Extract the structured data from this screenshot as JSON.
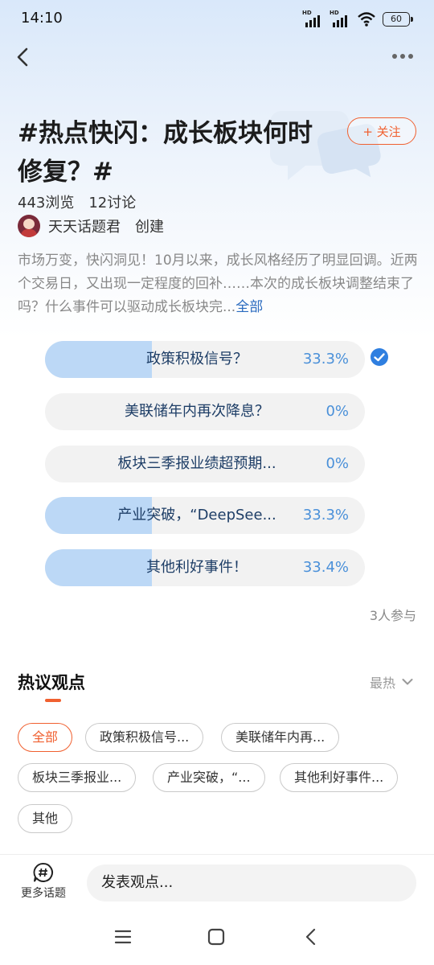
{
  "status_bar": {
    "time": "14:10",
    "network_label": "HD",
    "battery": "60",
    "icons": [
      "signal-icon",
      "signal-icon",
      "wifi-icon",
      "battery-icon"
    ]
  },
  "nav": {
    "back_icon": "chevron-left-icon",
    "more_icon": "more-dots-icon"
  },
  "topic": {
    "title": "#热点快闪：成长板块何时修复？#",
    "follow_label": "+ 关注",
    "views": "443浏览",
    "discussions": "12讨论",
    "creator_name": "天天话题君",
    "creator_action": "创建",
    "description": "市场万变，快闪洞见！10月以来，成长风格经历了明显回调。近两个交易日，又出现一定程度的回补……本次的成长板块调整结束了吗？什么事件可以驱动成长板块完...",
    "description_more": "全部"
  },
  "poll": {
    "options": [
      {
        "label": "政策积极信号？",
        "percent": "33.3%",
        "fill": 0.333,
        "selected": true
      },
      {
        "label": "美联储年内再次降息？",
        "percent": "0%",
        "fill": 0,
        "selected": false
      },
      {
        "label": "板块三季报业绩超预期...",
        "percent": "0%",
        "fill": 0,
        "selected": false
      },
      {
        "label": "产业突破，“DeepSee...",
        "percent": "33.3%",
        "fill": 0.333,
        "selected": false
      },
      {
        "label": "其他利好事件！",
        "percent": "33.4%",
        "fill": 0.334,
        "selected": false
      }
    ],
    "participants": "3人参与"
  },
  "hot_views": {
    "title": "热议观点",
    "sort_label": "最热",
    "filters": [
      "全部",
      "政策积极信号...",
      "美联储年内再...",
      "板块三季报业...",
      "产业突破，“...",
      "其他利好事件...",
      "其他"
    ]
  },
  "bottom_bar": {
    "more_topics_label": "更多话题",
    "comment_placeholder": "发表观点..."
  },
  "colors": {
    "accent": "#f06030",
    "poll_fill": "#bcd8f6",
    "poll_text": "#1d3d66",
    "percent": "#4a90d9",
    "link": "#2a6bbf"
  }
}
